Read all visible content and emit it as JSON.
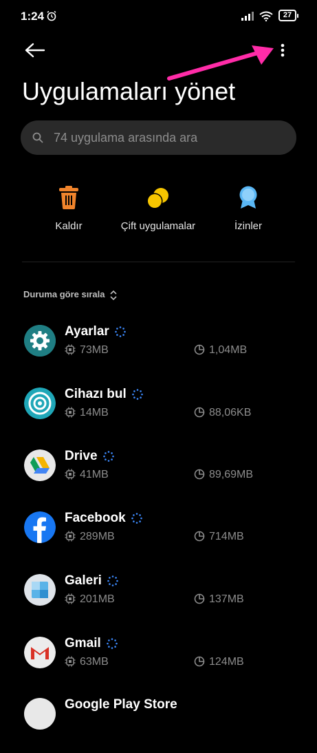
{
  "status": {
    "time": "1:24",
    "battery": "27"
  },
  "header": {
    "title": "Uygulamaları yönet"
  },
  "search": {
    "placeholder": "74 uygulama arasında ara"
  },
  "actions": [
    {
      "label": "Kaldır",
      "icon": "trash-icon",
      "color": "#f0842c"
    },
    {
      "label": "Çift uygulamalar",
      "icon": "dual-apps-icon",
      "color": "#f7c600"
    },
    {
      "label": "İzinler",
      "icon": "permissions-icon",
      "color": "#5ab7f5"
    }
  ],
  "sort": {
    "label": "Duruma göre sırala"
  },
  "apps": [
    {
      "name": "Ayarlar",
      "ram": "73MB",
      "storage": "1,04MB",
      "icon": "settings-gear-icon"
    },
    {
      "name": "Cihazı bul",
      "ram": "14MB",
      "storage": "88,06KB",
      "icon": "find-device-icon"
    },
    {
      "name": "Drive",
      "ram": "41MB",
      "storage": "89,69MB",
      "icon": "drive-icon"
    },
    {
      "name": "Facebook",
      "ram": "289MB",
      "storage": "714MB",
      "icon": "facebook-icon"
    },
    {
      "name": "Galeri",
      "ram": "201MB",
      "storage": "137MB",
      "icon": "gallery-icon"
    },
    {
      "name": "Gmail",
      "ram": "63MB",
      "storage": "124MB",
      "icon": "gmail-icon"
    },
    {
      "name": "Google Play Store",
      "icon": "play-store-icon"
    }
  ],
  "colors": {
    "accent": "#ff2ca8",
    "spinner": "#3d8bff"
  }
}
